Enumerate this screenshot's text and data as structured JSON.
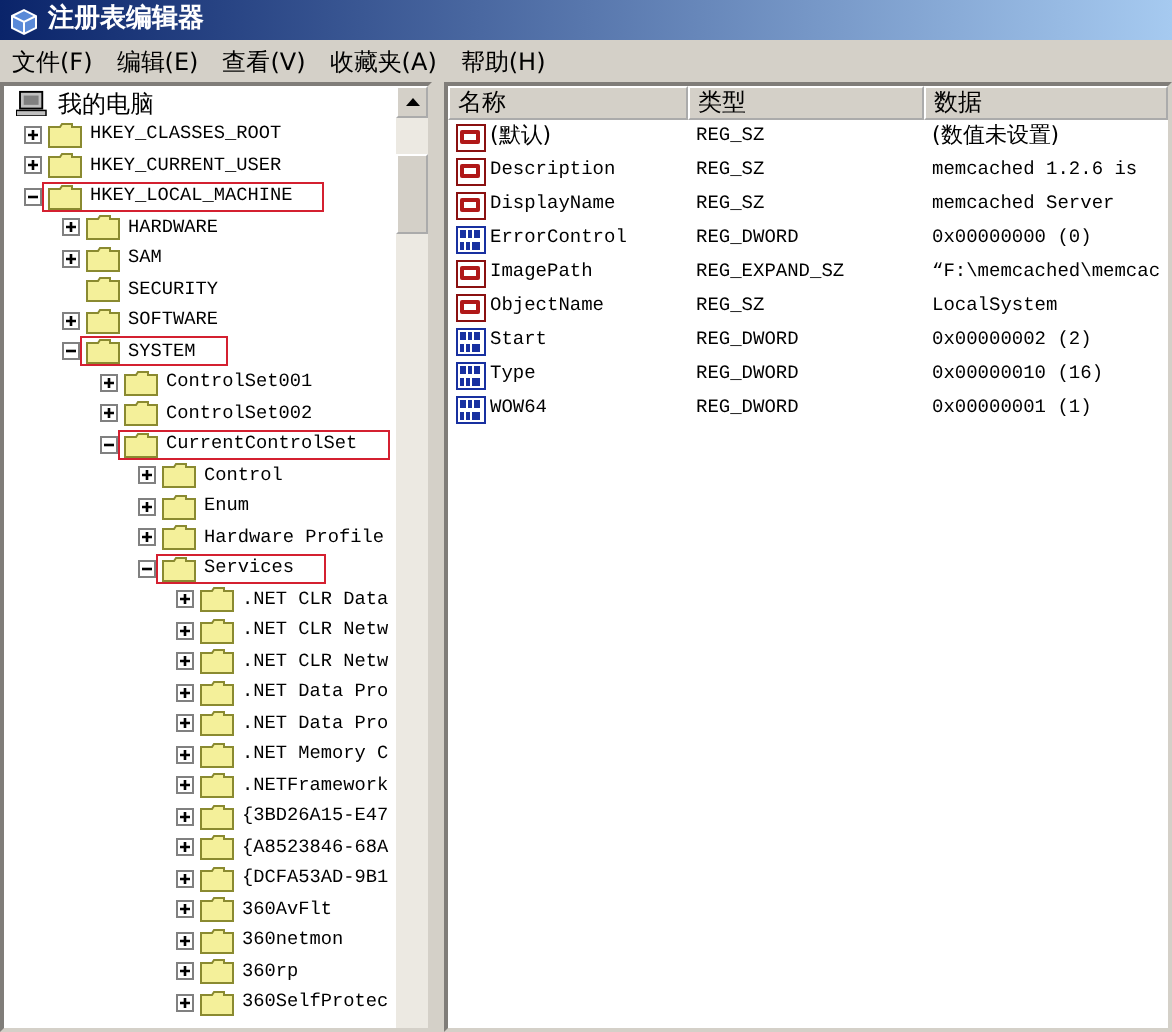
{
  "window": {
    "title": "注册表编辑器"
  },
  "menu": [
    "文件(F)",
    "编辑(E)",
    "查看(V)",
    "收藏夹(A)",
    "帮助(H)"
  ],
  "tree": {
    "label": "我的电脑",
    "children": [
      {
        "label": "HKEY_CLASSES_ROOT",
        "expanded": false
      },
      {
        "label": "HKEY_CURRENT_USER",
        "expanded": false
      },
      {
        "label": "HKEY_LOCAL_MACHINE",
        "expanded": true,
        "highlighted": true,
        "children": [
          {
            "label": "HARDWARE",
            "expanded": false
          },
          {
            "label": "SAM",
            "expanded": false
          },
          {
            "label": "SECURITY",
            "leaf": true
          },
          {
            "label": "SOFTWARE",
            "expanded": false
          },
          {
            "label": "SYSTEM",
            "expanded": true,
            "highlighted": true,
            "children": [
              {
                "label": "ControlSet001",
                "expanded": false
              },
              {
                "label": "ControlSet002",
                "expanded": false
              },
              {
                "label": "CurrentControlSet",
                "expanded": true,
                "highlighted": true,
                "children": [
                  {
                    "label": "Control",
                    "expanded": false
                  },
                  {
                    "label": "Enum",
                    "expanded": false
                  },
                  {
                    "label": "Hardware Profile",
                    "expanded": false
                  },
                  {
                    "label": "Services",
                    "expanded": true,
                    "highlighted": true,
                    "children": [
                      {
                        "label": ".NET CLR Data",
                        "expanded": false
                      },
                      {
                        "label": ".NET CLR Netw",
                        "expanded": false
                      },
                      {
                        "label": ".NET CLR Netw",
                        "expanded": false
                      },
                      {
                        "label": ".NET Data Pro",
                        "expanded": false
                      },
                      {
                        "label": ".NET Data Pro",
                        "expanded": false
                      },
                      {
                        "label": ".NET Memory C",
                        "expanded": false
                      },
                      {
                        "label": ".NETFramework",
                        "expanded": false
                      },
                      {
                        "label": "{3BD26A15-E47",
                        "expanded": false
                      },
                      {
                        "label": "{A8523846-68A",
                        "expanded": false
                      },
                      {
                        "label": "{DCFA53AD-9B1",
                        "expanded": false
                      },
                      {
                        "label": "360AvFlt",
                        "expanded": false
                      },
                      {
                        "label": "360netmon",
                        "expanded": false
                      },
                      {
                        "label": "360rp",
                        "expanded": false
                      },
                      {
                        "label": "360SelfProtec",
                        "expanded": false
                      }
                    ]
                  }
                ]
              }
            ]
          }
        ]
      }
    ]
  },
  "list": {
    "columns": [
      "名称",
      "类型",
      "数据"
    ],
    "rows": [
      {
        "kind": "string",
        "name": "(默认)",
        "type": "REG_SZ",
        "data": "(数值未设置)"
      },
      {
        "kind": "string",
        "name": "Description",
        "type": "REG_SZ",
        "data": "memcached 1.2.6 is"
      },
      {
        "kind": "string",
        "name": "DisplayName",
        "type": "REG_SZ",
        "data": "memcached Server"
      },
      {
        "kind": "binary",
        "name": "ErrorControl",
        "type": "REG_DWORD",
        "data": "0x00000000 (0)"
      },
      {
        "kind": "string",
        "name": "ImagePath",
        "type": "REG_EXPAND_SZ",
        "data": "“F:\\memcached\\memcac"
      },
      {
        "kind": "string",
        "name": "ObjectName",
        "type": "REG_SZ",
        "data": "LocalSystem"
      },
      {
        "kind": "binary",
        "name": "Start",
        "type": "REG_DWORD",
        "data": "0x00000002 (2)"
      },
      {
        "kind": "binary",
        "name": "Type",
        "type": "REG_DWORD",
        "data": "0x00000010 (16)"
      },
      {
        "kind": "binary",
        "name": "WOW64",
        "type": "REG_DWORD",
        "data": "0x00000001 (1)"
      }
    ]
  }
}
